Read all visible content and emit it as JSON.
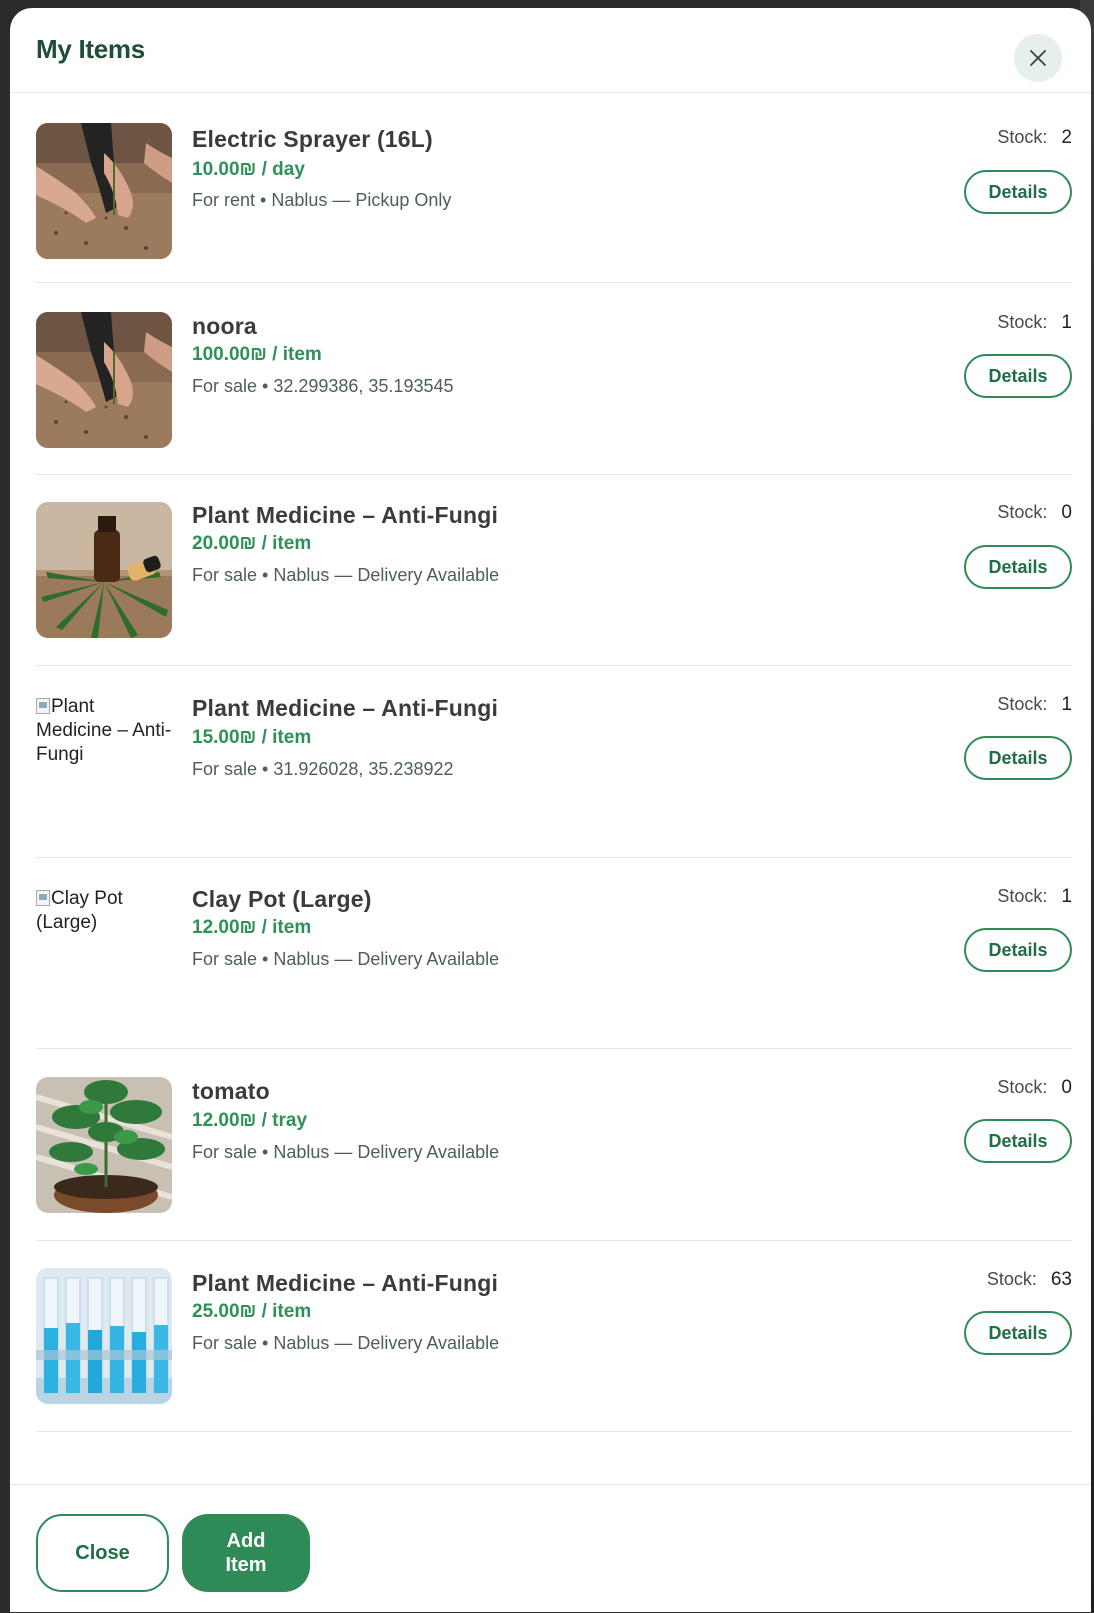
{
  "modal": {
    "title": "My Items",
    "close_icon": "close-icon"
  },
  "items": [
    {
      "name": "Electric Sprayer (16L)",
      "price": "10.00₪ / day",
      "meta": "For rent • Nablus — Pickup Only",
      "stock_label": "Stock:",
      "stock_value": "2",
      "details_label": "Details",
      "image": "hands-soil-photo"
    },
    {
      "name": "noora",
      "price": "100.00₪ / item",
      "meta": "For sale • 32.299386, 35.193545",
      "stock_label": "Stock:",
      "stock_value": "1",
      "details_label": "Details",
      "image": "hands-soil-photo"
    },
    {
      "name": "Plant Medicine – Anti-Fungi",
      "price": "20.00₪ / item",
      "meta": "For sale • Nablus — Delivery Available",
      "stock_label": "Stock:",
      "stock_value": "0",
      "details_label": "Details",
      "image": "oil-bottle-leaf-photo"
    },
    {
      "name": "Plant Medicine – Anti-Fungi",
      "price": "15.00₪ / item",
      "meta": "For sale • 31.926028, 35.238922",
      "stock_label": "Stock:",
      "stock_value": "1",
      "details_label": "Details",
      "image": "broken-image",
      "alt": "Plant Medicine – Anti-Fungi"
    },
    {
      "name": "Clay Pot (Large)",
      "price": "12.00₪ / item",
      "meta": "For sale • Nablus — Delivery Available",
      "stock_label": "Stock:",
      "stock_value": "1",
      "details_label": "Details",
      "image": "broken-image",
      "alt": "Clay Pot (Large)"
    },
    {
      "name": "tomato",
      "price": "12.00₪ / tray",
      "meta": "For sale • Nablus — Delivery Available",
      "stock_label": "Stock:",
      "stock_value": "0",
      "details_label": "Details",
      "image": "tomato-plant-photo"
    },
    {
      "name": "Plant Medicine – Anti-Fungi",
      "price": "25.00₪ / item",
      "meta": "For sale • Nablus — Delivery Available",
      "stock_label": "Stock:",
      "stock_value": "63",
      "details_label": "Details",
      "image": "test-tubes-photo"
    }
  ],
  "footer": {
    "close_label": "Close",
    "add_label_line1": "Add",
    "add_label_line2": "Item"
  },
  "colors": {
    "accent": "#2e8b57",
    "title": "#1f4d35",
    "price": "#2e9158"
  }
}
